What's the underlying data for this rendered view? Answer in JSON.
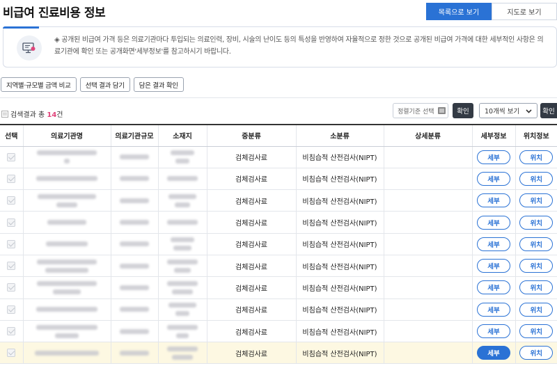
{
  "page": {
    "title": "비급여 진료비용 정보"
  },
  "view_toggle": {
    "list_label": "목록으로 보기",
    "map_label": "지도로 보기"
  },
  "notice": {
    "icon": "monitor-document-icon",
    "text": "◈ 공개된 비급여 가격 등은 의료기관마다 투입되는 의료인력, 장비, 시술의 난이도 등의 특성을 반영하여 자율적으로 정한 것으로 공개된 비급여 가격에 대한 세부적인 사항은 의료기관에 확인 또는 공개화면'세부정보'를 참고하시기 바랍니다."
  },
  "actions": {
    "compare_label": "지역별·규모별 금액 비교",
    "add_label": "선택 결과 담기",
    "check_label": "담은 결과 확인"
  },
  "results": {
    "prefix": "검색결과 총 ",
    "count": "14",
    "suffix": "건"
  },
  "sort": {
    "placeholder": "정렬기준 선택",
    "confirm_label": "확인"
  },
  "pagesize": {
    "value": "10개씩 보기",
    "confirm_label": "확인"
  },
  "table": {
    "headers": [
      "선택",
      "의료기관명",
      "의료기관규모",
      "소재지",
      "중분류",
      "소분류",
      "상세분류",
      "세부정보",
      "위치정보"
    ],
    "rows": [
      {
        "mid": "검체검사료",
        "sub": "비침습적 산전검사(NIPT)",
        "detail": "세부",
        "loc": "위치"
      },
      {
        "mid": "검체검사료",
        "sub": "비침습적 산전검사(NIPT)",
        "detail": "세부",
        "loc": "위치"
      },
      {
        "mid": "검체검사료",
        "sub": "비침습적 산전검사(NIPT)",
        "detail": "세부",
        "loc": "위치"
      },
      {
        "mid": "검체검사료",
        "sub": "비침습적 산전검사(NIPT)",
        "detail": "세부",
        "loc": "위치"
      },
      {
        "mid": "검체검사료",
        "sub": "비침습적 산전검사(NIPT)",
        "detail": "세부",
        "loc": "위치"
      },
      {
        "mid": "검체검사료",
        "sub": "비침습적 산전검사(NIPT)",
        "detail": "세부",
        "loc": "위치"
      },
      {
        "mid": "검체검사료",
        "sub": "비침습적 산전검사(NIPT)",
        "detail": "세부",
        "loc": "위치"
      },
      {
        "mid": "검체검사료",
        "sub": "비침습적 산전검사(NIPT)",
        "detail": "세부",
        "loc": "위치"
      },
      {
        "mid": "검체검사료",
        "sub": "비침습적 산전검사(NIPT)",
        "detail": "세부",
        "loc": "위치"
      },
      {
        "mid": "검체검사료",
        "sub": "비침습적 산전검사(NIPT)",
        "detail": "세부",
        "loc": "위치"
      }
    ]
  }
}
